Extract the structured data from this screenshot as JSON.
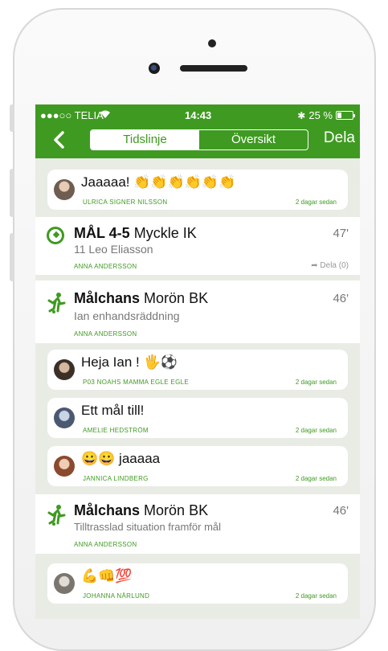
{
  "status_bar": {
    "carrier": "●●●○○ TELIA",
    "time": "14:43",
    "battery": "25 %"
  },
  "nav": {
    "segments": [
      "Tidslinje",
      "Översikt"
    ],
    "share": "Dela"
  },
  "feed": {
    "items": [
      {
        "type": "comment",
        "text": "Jaaaaa! 👏👏👏👏👏👏",
        "author": "ULRICA SIGNER NILSSON",
        "time": "2 dagar sedan"
      },
      {
        "type": "goal",
        "title_bold": "MÅL 4-5",
        "team": "Myckle IK",
        "minute": "47'",
        "subtitle": "11 Leo Eliasson",
        "author": "ANNA ANDERSSON",
        "share": "Dela (0)"
      },
      {
        "type": "chance",
        "title_bold": "Målchans",
        "team": "Morön BK",
        "minute": "46'",
        "subtitle": "Ian enhandsräddning",
        "author": "ANNA ANDERSSON"
      },
      {
        "type": "comment",
        "text": "Heja Ian ! 🖐⚽",
        "author": "P03 NOAHS MAMMA EGLE EGLE",
        "time": "2 dagar sedan"
      },
      {
        "type": "comment",
        "text": "Ett mål till!",
        "author": "AMELIE HEDSTRÖM",
        "time": "2 dagar sedan"
      },
      {
        "type": "comment",
        "text": "😀😀 jaaaaa",
        "author": "JANNICA LINDBERG",
        "time": "2 dagar sedan"
      },
      {
        "type": "chance",
        "title_bold": "Målchans",
        "team": "Morön BK",
        "minute": "46'",
        "subtitle": "Tilltrasslad situation framför mål",
        "author": "ANNA ANDERSSON"
      },
      {
        "type": "comment",
        "text": "💪👊💯",
        "author": "JOHANNA NÄRLUND",
        "time": "2 dagar sedan"
      }
    ]
  },
  "colors": {
    "brand_green": "#3f9a21",
    "feed_bg": "#e9ece5"
  }
}
